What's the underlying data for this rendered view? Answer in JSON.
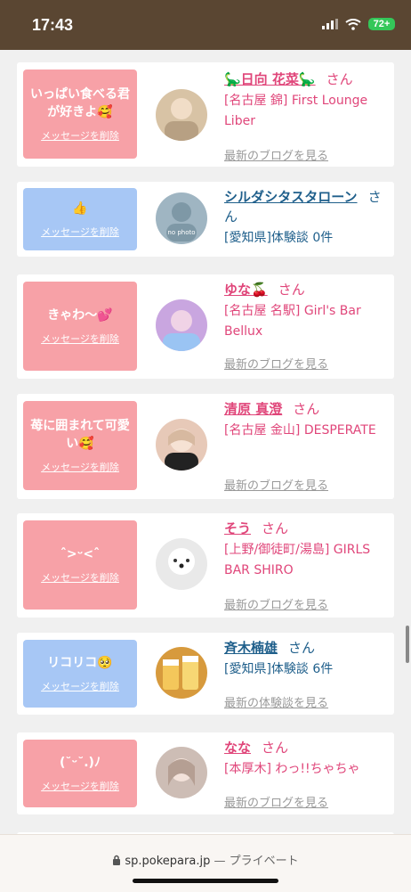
{
  "status_bar": {
    "time": "17:43",
    "battery": "72+"
  },
  "cards": [
    {
      "bubble_color": "pink",
      "message": "いっぱい食べる君が好きよ🥰",
      "delete_label": "メッセージを削除",
      "name": "🦕日向 花菜🦕",
      "honorific": "さん",
      "shop": "[名古屋 錦] First Lounge Liber",
      "link": "最新のブログを見る",
      "avatar_bg": "#d8c3a5",
      "name_color": "pink"
    },
    {
      "bubble_color": "blue",
      "message": "👍",
      "delete_label": "メッセージを削除",
      "name": "シルダシタスタローン",
      "honorific": "さん",
      "shop": "[愛知県]体験談 0件",
      "avatar_bg": "#9fb5c2",
      "avatar_text": "no photo",
      "name_color": "blue"
    },
    {
      "bubble_color": "pink",
      "message": "きゃわ〜💕",
      "delete_label": "メッセージを削除",
      "name": "ゆな🍒",
      "honorific": "さん",
      "shop": "[名古屋 名駅] Girl's Bar Bellux",
      "link": "最新のブログを見る",
      "avatar_bg": "#c9a6e0",
      "name_color": "pink"
    },
    {
      "bubble_color": "pink",
      "message": "苺に囲まれて可愛い🥰",
      "delete_label": "メッセージを削除",
      "name": "清原 真澄",
      "honorific": "さん",
      "shop": "[名古屋 金山] DESPERATE",
      "link": "最新のブログを見る",
      "avatar_bg": "#e7c9b8",
      "name_color": "pink"
    },
    {
      "bubble_color": "pink",
      "message": "ˆ>ᵕ<ˆ",
      "delete_label": "メッセージを削除",
      "name": "そう",
      "honorific": "さん",
      "shop": "[上野/御徒町/湯島] GIRLS BAR SHIRO",
      "link": "最新のブログを見る",
      "avatar_bg": "#e9e9e9",
      "name_color": "pink"
    },
    {
      "bubble_color": "blue",
      "message": "リコリコ🥺",
      "delete_label": "メッセージを削除",
      "name": "斉木楠雄",
      "honorific": "さん",
      "shop": "[愛知県]体験談 6件",
      "link": "最新の体験談を見る",
      "avatar_bg": "#d79a3d",
      "name_color": "blue"
    },
    {
      "bubble_color": "pink",
      "message": "(˘ᵕ˘.)ﾉ",
      "delete_label": "メッセージを削除",
      "name": "なな",
      "honorific": "さん",
      "shop": "[本厚木] わっ!!ちゃちゃ",
      "link": "最新のブログを見る",
      "avatar_bg": "#cdbdb5",
      "name_color": "pink"
    }
  ],
  "url_bar": {
    "domain": "sp.pokepara.jp",
    "mode": "— プライベート"
  }
}
